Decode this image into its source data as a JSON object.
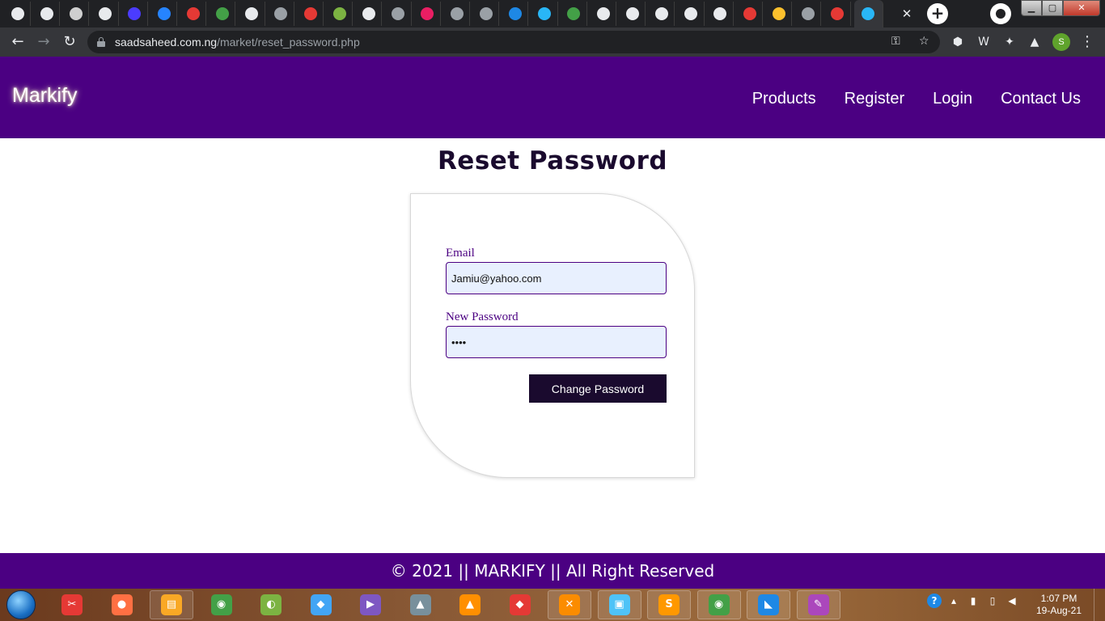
{
  "browser": {
    "tabs": [
      {
        "icon": "globe-icon",
        "glyph": "",
        "color": "#e8eaed"
      },
      {
        "icon": "globe-icon",
        "glyph": "",
        "color": "#e8eaed"
      },
      {
        "icon": "openai-icon",
        "glyph": "",
        "color": "#cfcfcf"
      },
      {
        "icon": "globe-icon",
        "glyph": "",
        "color": "#e8eaed"
      },
      {
        "icon": "bookmark-icon",
        "glyph": "",
        "color": "#4b3cff"
      },
      {
        "icon": "jira-icon",
        "glyph": "",
        "color": "#2684ff"
      },
      {
        "icon": "asterisk-icon",
        "glyph": "",
        "color": "#e53935"
      },
      {
        "icon": "s-icon",
        "glyph": "",
        "color": "#43a047"
      },
      {
        "icon": "seven-icon",
        "glyph": "",
        "color": "#e8eaed"
      },
      {
        "icon": "github-icon",
        "glyph": "",
        "color": "#9aa0a6"
      },
      {
        "icon": "target-icon",
        "glyph": "",
        "color": "#e53935"
      },
      {
        "icon": "game-icon",
        "glyph": "",
        "color": "#7cb342"
      },
      {
        "icon": "globe-icon",
        "glyph": "",
        "color": "#e8eaed"
      },
      {
        "icon": "upwork-icon",
        "glyph": "",
        "color": "#9aa0a6"
      },
      {
        "icon": "music-icon",
        "glyph": "",
        "color": "#e91e63"
      },
      {
        "icon": "play-icon",
        "glyph": "",
        "color": "#9aa0a6"
      },
      {
        "icon": "play-icon",
        "glyph": "",
        "color": "#9aa0a6"
      },
      {
        "icon": "atom-icon",
        "glyph": "",
        "color": "#1e88e5"
      },
      {
        "icon": "y-icon",
        "glyph": "",
        "color": "#29b6f6"
      },
      {
        "icon": "hashnode-icon",
        "glyph": "",
        "color": "#43a047"
      },
      {
        "icon": "globe-icon",
        "glyph": "",
        "color": "#e8eaed"
      },
      {
        "icon": "drive-icon",
        "glyph": "",
        "color": "#e8eaed"
      },
      {
        "icon": "chart-icon",
        "glyph": "",
        "color": "#e8eaed"
      },
      {
        "icon": "globe-icon",
        "glyph": "",
        "color": "#e8eaed"
      },
      {
        "icon": "avatar-icon",
        "glyph": "",
        "color": "#e8eaed"
      },
      {
        "icon": "star-icon",
        "glyph": "",
        "color": "#e53935"
      },
      {
        "icon": "mountain-icon",
        "glyph": "",
        "color": "#fbc02d"
      },
      {
        "icon": "laravel-icon",
        "glyph": "",
        "color": "#9aa0a6"
      },
      {
        "icon": "pdf-icon",
        "glyph": "",
        "color": "#e53935"
      },
      {
        "icon": "stripe-icon",
        "glyph": "",
        "color": "#29b6f6"
      }
    ],
    "url_host": "saadsaheed.com.ng",
    "url_path": "/market/reset_password.php",
    "profile_initial": "S"
  },
  "site": {
    "brand": "Markify",
    "nav": [
      "Products",
      "Register",
      "Login",
      "Contact Us"
    ],
    "header_color": "#4b0082",
    "page_title": "Reset Password",
    "form": {
      "email_label": "Email",
      "email_value": "Jamiu@yahoo.com",
      "password_label": "New Password",
      "password_value": "••••",
      "submit_label": "Change Password"
    },
    "footer": "© 2021 || MARKIFY || All Right Reserved"
  },
  "taskbar": {
    "apps": [
      {
        "icon": "snipping-tool-icon",
        "glyph": "✂",
        "color": "#e53935",
        "pinned": false
      },
      {
        "icon": "firefox-icon",
        "glyph": "●",
        "color": "#ff7043",
        "pinned": false
      },
      {
        "icon": "file-explorer-icon",
        "glyph": "▤",
        "color": "#f9a825",
        "pinned": true
      },
      {
        "icon": "chrome-icon",
        "glyph": "◉",
        "color": "#43a047",
        "pinned": false
      },
      {
        "icon": "chameleon-icon",
        "glyph": "◐",
        "color": "#7cb342",
        "pinned": false
      },
      {
        "icon": "virtualbox-icon",
        "glyph": "◆",
        "color": "#42a5f5",
        "pinned": false
      },
      {
        "icon": "visual-studio-icon",
        "glyph": "▶",
        "color": "#7e57c2",
        "pinned": false
      },
      {
        "icon": "tree-icon",
        "glyph": "▲",
        "color": "#78909c",
        "pinned": false
      },
      {
        "icon": "vlc-icon",
        "glyph": "▲",
        "color": "#ff8f00",
        "pinned": false
      },
      {
        "icon": "git-icon",
        "glyph": "◆",
        "color": "#e53935",
        "pinned": false
      },
      {
        "icon": "xampp-icon",
        "glyph": "✕",
        "color": "#fb8c00",
        "pinned": true
      },
      {
        "icon": "photos-icon",
        "glyph": "▣",
        "color": "#4fc3f7",
        "pinned": true
      },
      {
        "icon": "sublime-text-icon",
        "glyph": "S",
        "color": "#ff9800",
        "pinned": true
      },
      {
        "icon": "chrome-active-icon",
        "glyph": "◉",
        "color": "#43a047",
        "pinned": true
      },
      {
        "icon": "vscode-icon",
        "glyph": "◣",
        "color": "#1e88e5",
        "pinned": true
      },
      {
        "icon": "paint-icon",
        "glyph": "✎",
        "color": "#ab47bc",
        "pinned": true
      }
    ],
    "time": "1:07 PM",
    "date": "19-Aug-21"
  }
}
